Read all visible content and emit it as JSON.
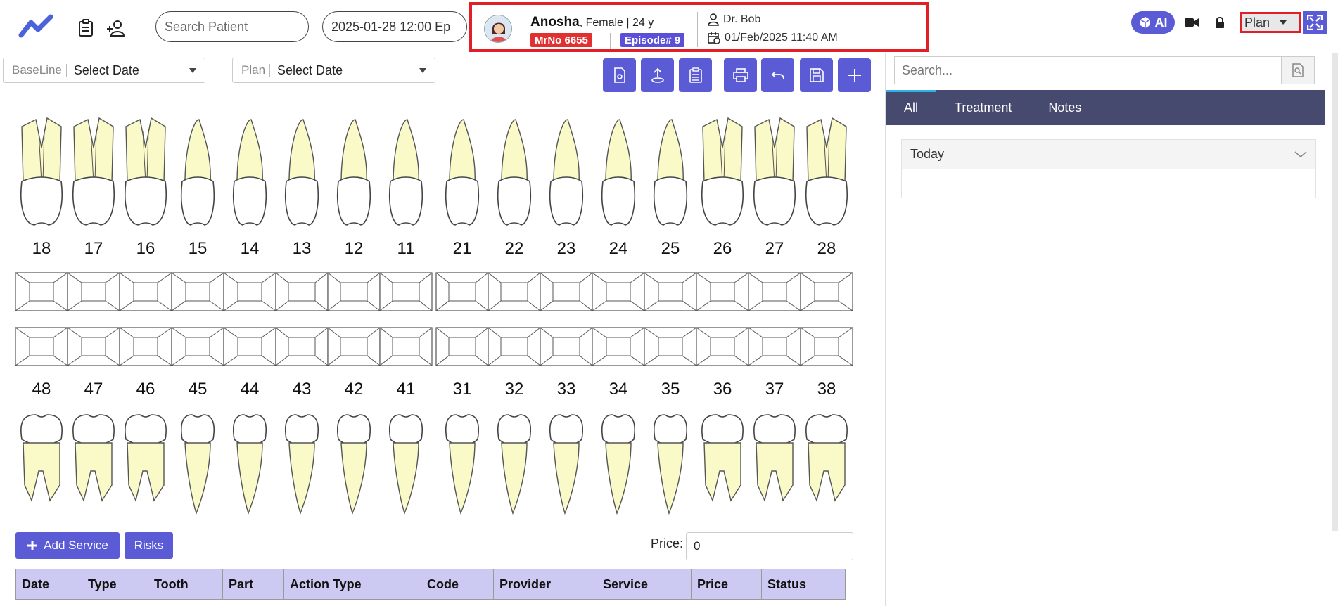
{
  "header": {
    "search_placeholder": "Search Patient",
    "episode_date": "2025-01-28 12:00 Ep",
    "patient": {
      "name": "Anosha",
      "meta": ", Female | 24 y",
      "mrno": "MrNo 6655",
      "episode": "Episode# 9",
      "doctor": "Dr. Bob",
      "visit_datetime": "01/Feb/2025 11:40 AM"
    },
    "ai_label": "AI",
    "mode_select": "Plan"
  },
  "filters": {
    "baseline_label": "BaseLine",
    "baseline_value": "Select Date",
    "plan_label": "Plan",
    "plan_value": "Select Date"
  },
  "toolbar": {
    "icons": [
      "view-icon",
      "upload-icon",
      "clipboard-icon",
      "print-icon",
      "undo-icon",
      "save-icon",
      "plus-icon"
    ]
  },
  "teeth": {
    "upper": [
      "18",
      "17",
      "16",
      "15",
      "14",
      "13",
      "12",
      "11",
      "21",
      "22",
      "23",
      "24",
      "25",
      "26",
      "27",
      "28"
    ],
    "lower": [
      "48",
      "47",
      "46",
      "45",
      "44",
      "43",
      "42",
      "41",
      "31",
      "32",
      "33",
      "34",
      "35",
      "36",
      "37",
      "38"
    ]
  },
  "services": {
    "add_label": "Add Service",
    "risks_label": "Risks",
    "price_label": "Price:",
    "price_value": "0",
    "columns": [
      "Date",
      "Type",
      "Tooth",
      "Part",
      "Action Type",
      "Code",
      "Provider",
      "Service",
      "Price",
      "Status"
    ]
  },
  "right_panel": {
    "search_placeholder": "Search...",
    "tabs": [
      "All",
      "Treatment",
      "Notes"
    ],
    "section_title": "Today"
  },
  "colors": {
    "accent": "#5b5bd6",
    "tab_bar": "#474a6f",
    "highlight_border": "#e01f26",
    "root": "#fafac8",
    "table_header": "#cccaf2"
  }
}
